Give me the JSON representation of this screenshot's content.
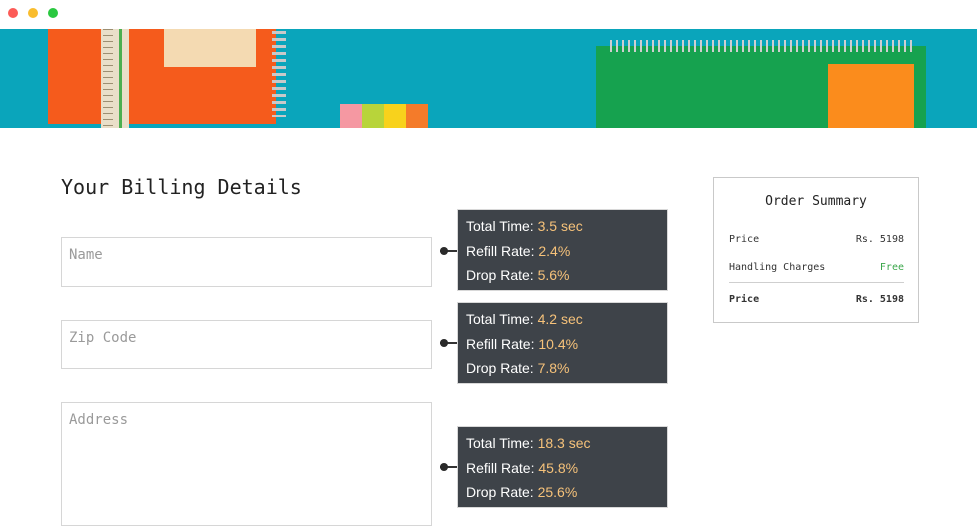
{
  "window": {
    "controls": [
      "close",
      "minimize",
      "maximize"
    ]
  },
  "billing": {
    "heading": "Your Billing Details",
    "name_placeholder": "Name",
    "zip_placeholder": "Zip Code",
    "address_placeholder": "Address"
  },
  "stats": [
    {
      "total_label": "Total Time:",
      "total_value": "3.5 sec",
      "refill_label": "Refill Rate:",
      "refill_value": "2.4%",
      "drop_label": "Drop Rate:",
      "drop_value": "5.6%"
    },
    {
      "total_label": "Total Time:",
      "total_value": "4.2 sec",
      "refill_label": "Refill Rate:",
      "refill_value": "10.4%",
      "drop_label": "Drop Rate:",
      "drop_value": "7.8%"
    },
    {
      "total_label": "Total Time:",
      "total_value": "18.3 sec",
      "refill_label": "Refill Rate:",
      "refill_value": "45.8%",
      "drop_label": "Drop Rate:",
      "drop_value": "25.6%"
    }
  ],
  "summary": {
    "title": "Order Summary",
    "price_label": "Price",
    "price_value": "Rs. 5198",
    "handling_label": "Handling Charges",
    "handling_value": "Free",
    "total_label": "Price",
    "total_value": "Rs. 5198"
  },
  "colors": {
    "stat_bg": "#3e4349",
    "stat_value": "#f6c27a",
    "free": "#3aa64a",
    "hero_bg": "#0aa5bb"
  }
}
